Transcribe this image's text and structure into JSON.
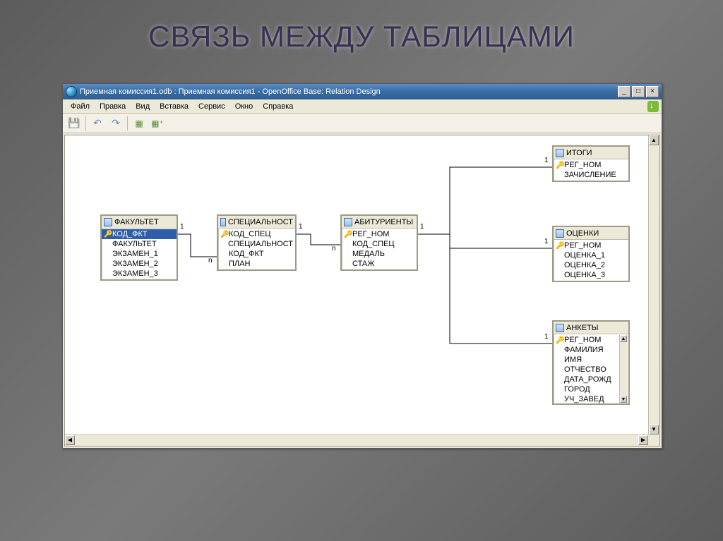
{
  "slide_title": "СВЯЗЬ МЕЖДУ ТАБЛИЦАМИ",
  "window_title": "Приемная комиссия1.odb : Приемная комиссия1 - OpenOffice Base: Relation Design",
  "menu": {
    "file": "Файл",
    "edit": "Правка",
    "view": "Вид",
    "insert": "Вставка",
    "tools": "Сервис",
    "window": "Окно",
    "help": "Справка"
  },
  "win_buttons": {
    "min": "_",
    "max": "□",
    "close": "×"
  },
  "tables": {
    "fakultet": {
      "title": "ФАКУЛЬТЕТ",
      "fields": [
        "КОД_ФКТ",
        "ФАКУЛЬТЕТ",
        "ЭКЗАМЕН_1",
        "ЭКЗАМЕН_2",
        "ЭКЗАМЕН_3"
      ],
      "pk_index": 0,
      "selected_index": 0
    },
    "specialnost": {
      "title": "СПЕЦИАЛЬНОСТ",
      "fields": [
        "КОД_СПЕЦ",
        "СПЕЦИАЛЬНОСТ",
        "КОД_ФКТ",
        "ПЛАН"
      ],
      "pk_index": 0
    },
    "abiturienty": {
      "title": "АБИТУРИЕНТЫ",
      "fields": [
        "РЕГ_НОМ",
        "КОД_СПЕЦ",
        "МЕДАЛЬ",
        "СТАЖ"
      ],
      "pk_index": 0
    },
    "itogi": {
      "title": "ИТОГИ",
      "fields": [
        "РЕГ_НОМ",
        "ЗАЧИСЛЕНИЕ"
      ],
      "pk_index": 0
    },
    "ocenki": {
      "title": "ОЦЕНКИ",
      "fields": [
        "РЕГ_НОМ",
        "ОЦЕНКА_1",
        "ОЦЕНКА_2",
        "ОЦЕНКА_3"
      ],
      "pk_index": 0
    },
    "ankety": {
      "title": "АНКЕТЫ",
      "fields": [
        "РЕГ_НОМ",
        "ФАМИЛИЯ",
        "ИМЯ",
        "ОТЧЕСТВО",
        "ДАТА_РОЖД",
        "ГОРОД",
        "УЧ_ЗАВЕД"
      ],
      "pk_index": 0
    }
  },
  "relations": {
    "one": "1",
    "many": "n"
  }
}
